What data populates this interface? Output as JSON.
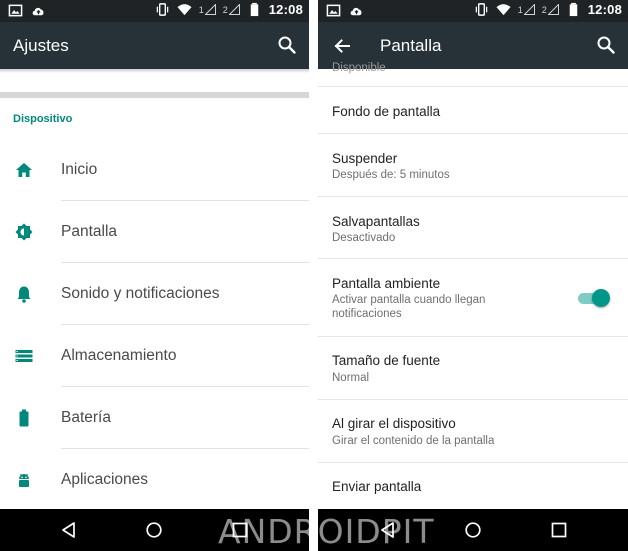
{
  "status": {
    "time": "12:08",
    "sim1": "1",
    "sim2": "2"
  },
  "left": {
    "title": "Ajustes",
    "section": "Dispositivo",
    "items": [
      {
        "label": "Inicio",
        "icon": "home-icon"
      },
      {
        "label": "Pantalla",
        "icon": "brightness-icon"
      },
      {
        "label": "Sonido y notificaciones",
        "icon": "bell-icon"
      },
      {
        "label": "Almacenamiento",
        "icon": "storage-icon"
      },
      {
        "label": "Batería",
        "icon": "battery-icon"
      },
      {
        "label": "Aplicaciones",
        "icon": "android-icon"
      }
    ]
  },
  "right": {
    "title": "Pantalla",
    "cut_subtitle": "Disponible",
    "items": [
      {
        "title": "Fondo de pantalla",
        "subtitle": ""
      },
      {
        "title": "Suspender",
        "subtitle": "Después de: 5 minutos"
      },
      {
        "title": "Salvapantallas",
        "subtitle": "Desactivado"
      },
      {
        "title": "Pantalla ambiente",
        "subtitle": "Activar pantalla cuando llegan notificaciones",
        "toggle_on": true
      },
      {
        "title": "Tamaño de fuente",
        "subtitle": "Normal"
      },
      {
        "title": "Al girar el dispositivo",
        "subtitle": "Girar el contenido de la pantalla"
      },
      {
        "title": "Enviar pantalla",
        "subtitle": ""
      }
    ]
  },
  "watermark": "ANDROIDPIT",
  "colors": {
    "accent": "#009688",
    "section": "#00897b",
    "appbar": "#263238",
    "statusbar": "#1f2326"
  }
}
